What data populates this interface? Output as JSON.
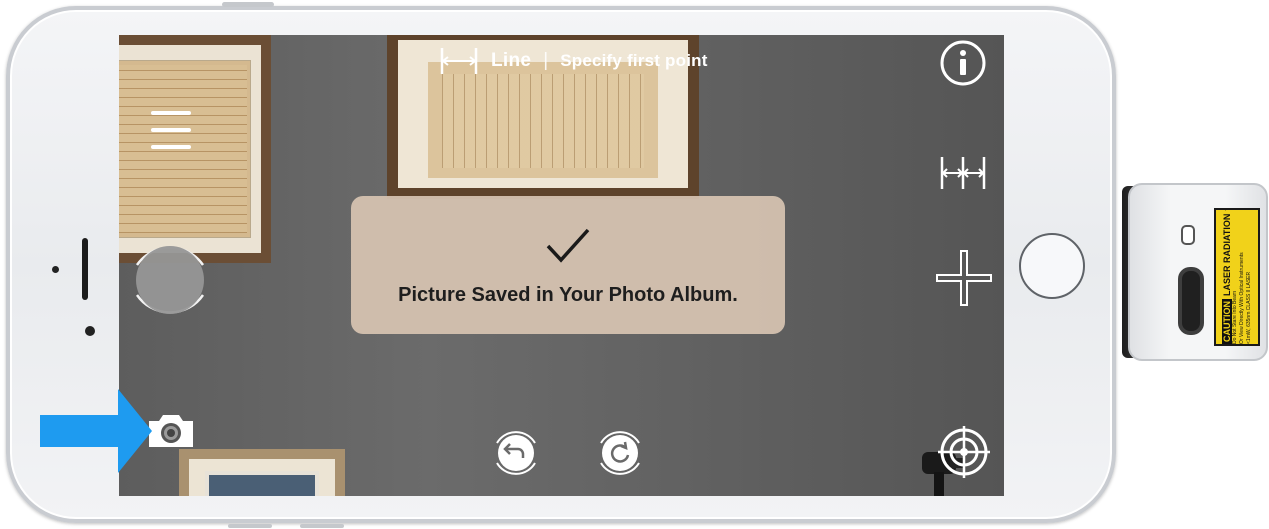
{
  "toolbar": {
    "mode_label": "Line",
    "separator": "|",
    "instruction": "Specify first point"
  },
  "toast": {
    "message": "Picture Saved in Your Photo Album."
  },
  "device_label": {
    "caution": "CAUTION",
    "heading": "LASER RADIATION",
    "line1": "Do Not Stare Into Beam",
    "line2": "Or View Directly With Optical Instruments",
    "line3": "<1mW, 635nm CLASS II LASER"
  },
  "icons": {
    "menu": "hamburger-menu-icon",
    "info": "info-icon",
    "measure_mode": "multi-segment-measure-icon",
    "crosshair": "crosshair-plus-icon",
    "target": "target-reticle-icon",
    "undo": "undo-icon",
    "redo": "redo-icon",
    "camera": "camera-icon",
    "shutter": "shutter-icon",
    "check": "checkmark-icon",
    "line_mode": "line-measure-icon",
    "arrow": "pointer-arrow-icon"
  },
  "colors": {
    "overlay_white": "#ffffff",
    "toast_bg": "#d7c4b2",
    "arrow": "#1e9bf0",
    "label_yellow": "#f1d21a"
  }
}
